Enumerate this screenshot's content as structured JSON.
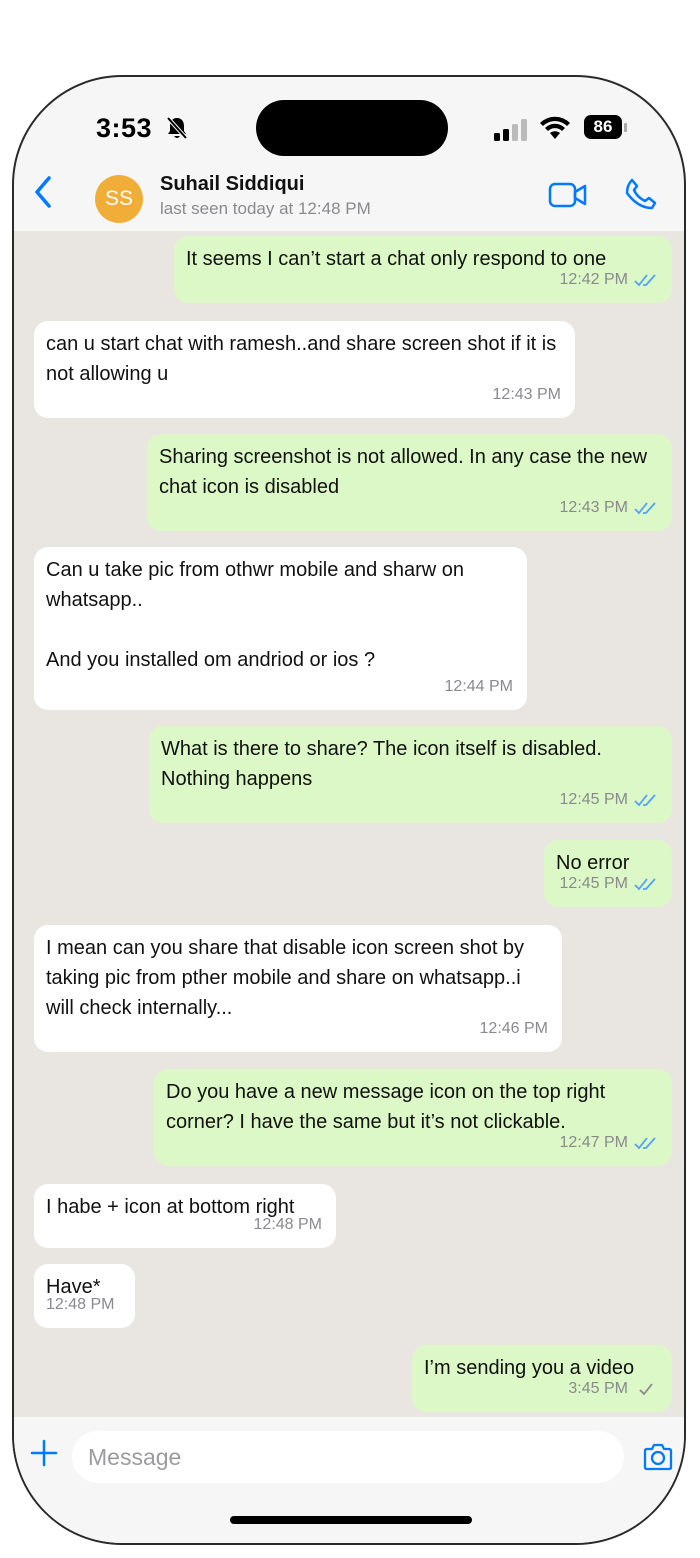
{
  "status_bar": {
    "time": "3:53",
    "battery": "86"
  },
  "header": {
    "avatar_initials": "SS",
    "contact_name": "Suhail Siddiqui",
    "contact_status": "last seen today at 12:48 PM",
    "avatar_color": "#f0ae38",
    "accent_color": "#007aff"
  },
  "messages": [
    {
      "dir": "out",
      "text": "It seems I can’t start a chat only respond to one",
      "time": "12:42 PM",
      "receipt": "read"
    },
    {
      "dir": "in",
      "text": "can u start chat with ramesh..and share screen shot if it is not allowing u",
      "time": "12:43 PM"
    },
    {
      "dir": "out",
      "text": "Sharing screenshot is not allowed. In any case the new chat icon is disabled",
      "time": "12:43 PM",
      "receipt": "read"
    },
    {
      "dir": "in",
      "text": "Can u take pic from othwr mobile and sharw on whatsapp..\n\nAnd you installed om andriod or ios ?",
      "time": "12:44 PM"
    },
    {
      "dir": "out",
      "text": "What is there to share? The icon itself is disabled. Nothing happens",
      "time": "12:45 PM",
      "receipt": "read"
    },
    {
      "dir": "out",
      "text": "No error",
      "time": "12:45 PM",
      "receipt": "read"
    },
    {
      "dir": "in",
      "text": "I mean can you share that disable icon screen shot by taking pic from pther mobile and share on whatsapp..i will check internally...",
      "time": "12:46 PM"
    },
    {
      "dir": "out",
      "text": "Do you have a new message icon on the top right corner? I have the same but it’s not clickable.",
      "time": "12:47 PM",
      "receipt": "read"
    },
    {
      "dir": "in",
      "text": "I habe + icon at bottom right",
      "time": "12:48 PM"
    },
    {
      "dir": "in",
      "text": "Have*",
      "time": "12:48 PM"
    },
    {
      "dir": "out",
      "text": "I’m sending you a video",
      "time": "3:45 PM",
      "receipt": "sent"
    }
  ],
  "input": {
    "placeholder": "Message"
  },
  "colors": {
    "outgoing_bubble": "#dcf8c6",
    "incoming_bubble": "#ffffff",
    "chat_background": "#e9e6e1",
    "read_tick": "#4fa3f7",
    "sent_tick": "#8a8a8e"
  }
}
